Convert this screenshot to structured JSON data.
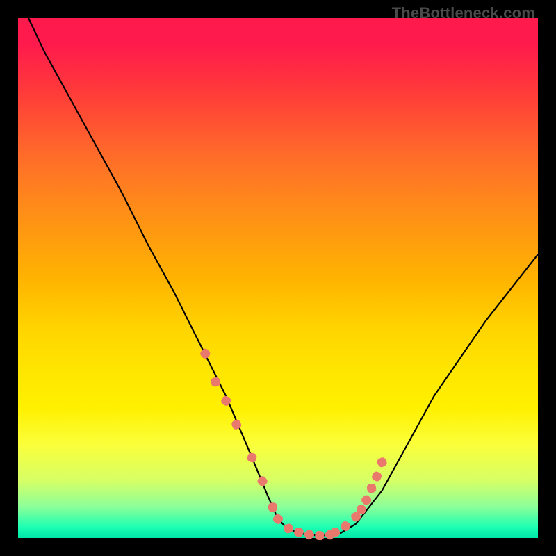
{
  "watermark": {
    "text": "TheBottleneck.com"
  },
  "colors": {
    "page_bg": "#000000",
    "curve": "#000000",
    "marker": "#e9786d",
    "gradient_stops": [
      "#ff1a4d",
      "#ff3a3a",
      "#ff6a2a",
      "#ff8a1a",
      "#ffb300",
      "#ffd500",
      "#ffe600",
      "#fff000",
      "#fbff3a",
      "#d6ff66",
      "#8cff99",
      "#1affb3",
      "#00e6a8"
    ]
  },
  "chart_data": {
    "type": "line",
    "title": "",
    "xlabel": "",
    "ylabel": "",
    "xlim": [
      0,
      100
    ],
    "ylim": [
      0,
      110
    ],
    "grid": false,
    "legend": false,
    "annotations": [],
    "series": [
      {
        "name": "curve",
        "x": [
          2,
          5,
          10,
          15,
          20,
          25,
          30,
          35,
          40,
          45,
          48,
          50,
          52,
          55,
          58,
          60,
          62,
          65,
          70,
          75,
          80,
          85,
          90,
          95,
          100
        ],
        "y": [
          110,
          103,
          93,
          83,
          73,
          62,
          52,
          41,
          30,
          17,
          9,
          4,
          1.8,
          0.8,
          0.5,
          0.6,
          1.0,
          3,
          10,
          20,
          30,
          38,
          46,
          53,
          60
        ]
      }
    ],
    "markers": {
      "name": "dots",
      "x": [
        36,
        38,
        40,
        42,
        45,
        47,
        49,
        50,
        52,
        54,
        56,
        58,
        60,
        61,
        63,
        65,
        66,
        67,
        68,
        69,
        70
      ],
      "y": [
        39,
        33,
        29,
        24,
        17,
        12,
        6.5,
        4,
        2.0,
        1.2,
        0.7,
        0.5,
        0.7,
        1.2,
        2.5,
        4.5,
        6.0,
        8.0,
        10.5,
        13.0,
        16.0
      ]
    },
    "marker_shape": "rounded-rect"
  }
}
